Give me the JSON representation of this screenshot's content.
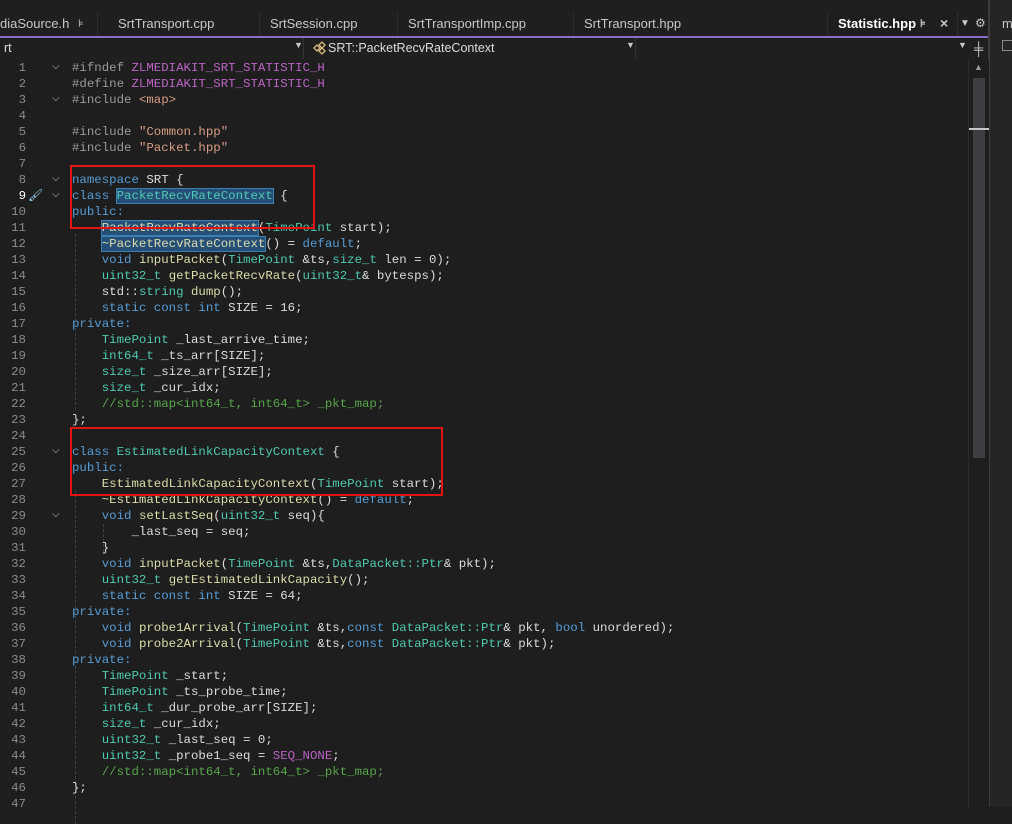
{
  "tabs": [
    {
      "label": "diaSource.h",
      "pin": "⊧"
    },
    {
      "label": "SrtTransport.cpp"
    },
    {
      "label": "SrtSession.cpp"
    },
    {
      "label": "SrtTransportImp.cpp"
    },
    {
      "label": "SrtTransport.hpp"
    },
    {
      "label": "Statistic.hpp",
      "active": true,
      "pin": "⊧",
      "close": "×"
    }
  ],
  "tab_overflow_glyph": "▼",
  "tab_settings_glyph": "⚙",
  "navbar": {
    "project": "rt",
    "scope": "SRT::PacketRecvRateContext",
    "member": ""
  },
  "right_panel": {
    "label": "m"
  },
  "editor": {
    "current_line": 9,
    "lines": [
      {
        "n": "1"
      },
      {
        "n": "2"
      },
      {
        "n": "3"
      },
      {
        "n": "4"
      },
      {
        "n": "5"
      },
      {
        "n": "6"
      },
      {
        "n": "7"
      },
      {
        "n": "8"
      },
      {
        "n": "9"
      },
      {
        "n": "10"
      },
      {
        "n": "11"
      },
      {
        "n": "12"
      },
      {
        "n": "13"
      },
      {
        "n": "14"
      },
      {
        "n": "15"
      },
      {
        "n": "16"
      },
      {
        "n": "17"
      },
      {
        "n": "18"
      },
      {
        "n": "19"
      },
      {
        "n": "20"
      },
      {
        "n": "21"
      },
      {
        "n": "22"
      },
      {
        "n": "23"
      },
      {
        "n": "24"
      },
      {
        "n": "25"
      },
      {
        "n": "26"
      },
      {
        "n": "27"
      },
      {
        "n": "28"
      },
      {
        "n": "29"
      },
      {
        "n": "30"
      },
      {
        "n": "31"
      },
      {
        "n": "32"
      },
      {
        "n": "33"
      },
      {
        "n": "34"
      },
      {
        "n": "35"
      },
      {
        "n": "36"
      },
      {
        "n": "37"
      },
      {
        "n": "38"
      },
      {
        "n": "39"
      },
      {
        "n": "40"
      },
      {
        "n": "41"
      },
      {
        "n": "42"
      },
      {
        "n": "43"
      },
      {
        "n": "44"
      },
      {
        "n": "45"
      },
      {
        "n": "46"
      },
      {
        "n": "47"
      }
    ],
    "code": {
      "l1_kw": "#ifndef",
      "l1_rest": "ZLMEDIAKIT_SRT_STATISTIC_H",
      "l2_kw": "#define",
      "l2_rest": "ZLMEDIAKIT_SRT_STATISTIC_H",
      "l3_kw": "#include",
      "l3_rest": "<map>",
      "l5_kw": "#include",
      "l5_rest": "\"Common.hpp\"",
      "l6_kw": "#include",
      "l6_rest": "\"Packet.hpp\"",
      "l8_kw": "namespace",
      "l8_rest": "SRT {",
      "l9_kw": "class",
      "l9_name": "PacketRecvRateContext",
      "l9_rest": "{",
      "l10_kw": "public:",
      "l11_name": "PacketRecvRateContext",
      "l11_ty": "TimePoint",
      "l11_rest": "start);",
      "l12_name": "~PacketRecvRateContext",
      "l12_mid": "() =",
      "l12_kw": "default",
      "l12_end": ";",
      "l13_kw": "void",
      "l13_fn": "inputPacket",
      "l13_ty": "TimePoint",
      "l13_mid": "&ts,",
      "l13_ty2": "size_t",
      "l13_rest": "len = 0);",
      "l14_ty": "uint32_t",
      "l14_fn": "getPacketRecvRate",
      "l14_ty2": "uint32_t",
      "l14_rest": "& bytesps);",
      "l15_pre": "std::",
      "l15_ty": "string",
      "l15_fn": "dump",
      "l15_rest": "();",
      "l16_kw": "static const int",
      "l16_rest": "SIZE = 16;",
      "l17_kw": "private:",
      "l18_ty": "TimePoint",
      "l18_rest": "_last_arrive_time;",
      "l19_ty": "int64_t",
      "l19_rest": "_ts_arr[SIZE];",
      "l20_ty": "size_t",
      "l20_rest": "_size_arr[SIZE];",
      "l21_ty": "size_t",
      "l21_rest": "_cur_idx;",
      "l22_cm": "//std::map<int64_t, int64_t> _pkt_map;",
      "l23_rest": "};",
      "l25_kw": "class",
      "l25_name": "EstimatedLinkCapacityContext",
      "l25_rest": "{",
      "l26_kw": "public:",
      "l27_fn": "EstimatedLinkCapacityContext",
      "l27_ty": "TimePoint",
      "l27_rest": "start);",
      "l28_fn": "~EstimatedLinkCapacityContext",
      "l28_mid": "() =",
      "l28_kw": "default",
      "l28_end": ";",
      "l29_kw": "void",
      "l29_fn": "setLastSeq",
      "l29_ty": "uint32_t",
      "l29_rest": "seq){",
      "l30_rest": "_last_seq = seq;",
      "l31_rest": "}",
      "l32_kw": "void",
      "l32_fn": "inputPacket",
      "l32_ty": "TimePoint",
      "l32_mid": "&ts,",
      "l32_ty2": "DataPacket::Ptr",
      "l32_rest": "& pkt);",
      "l33_ty": "uint32_t",
      "l33_fn": "getEstimatedLinkCapacity",
      "l33_rest": "();",
      "l34_kw": "static const int",
      "l34_rest": "SIZE = 64;",
      "l35_kw": "private:",
      "l36_kw": "void",
      "l36_fn": "probe1Arrival",
      "l36_ty": "TimePoint",
      "l36_mid": "&ts,",
      "l36_kw2": "const",
      "l36_ty2": "DataPacket::Ptr",
      "l36_mid2": "& pkt,",
      "l36_kw3": "bool",
      "l36_rest": "unordered);",
      "l37_kw": "void",
      "l37_fn": "probe2Arrival",
      "l37_ty": "TimePoint",
      "l37_mid": "&ts,",
      "l37_kw2": "const",
      "l37_ty2": "DataPacket::Ptr",
      "l37_rest": "& pkt);",
      "l38_kw": "private:",
      "l39_ty": "TimePoint",
      "l39_rest": "_start;",
      "l40_ty": "TimePoint",
      "l40_rest": "_ts_probe_time;",
      "l41_ty": "int64_t",
      "l41_rest": "_dur_probe_arr[SIZE];",
      "l42_ty": "size_t",
      "l42_rest": "_cur_idx;",
      "l43_ty": "uint32_t",
      "l43_rest": "_last_seq = 0;",
      "l44_ty": "uint32_t",
      "l44_mid": "_probe1_seq =",
      "l44_mac": "SEQ_NONE",
      "l44_end": ";",
      "l45_cm": "//std::map<int64_t, int64_t> _pkt_map;",
      "l46_rest": "};"
    }
  },
  "colors": {
    "accent": "#8a6cc6",
    "annotation_red": "#e51414",
    "keyword": "#569cd6",
    "type": "#4ec9b0",
    "function": "#dcdcaa",
    "string": "#d69d85",
    "comment": "#57a64a"
  }
}
